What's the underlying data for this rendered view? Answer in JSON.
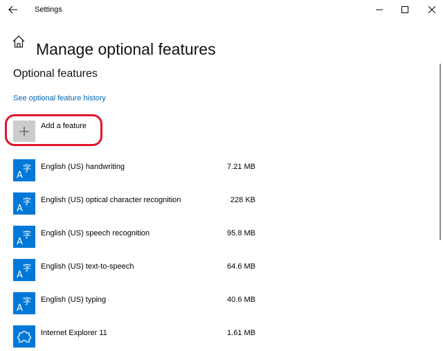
{
  "window": {
    "title": "Settings",
    "back_icon": "back-arrow-icon",
    "minimize_icon": "minimize-icon",
    "maximize_icon": "maximize-icon",
    "close_icon": "close-icon"
  },
  "page": {
    "title": "Manage optional features",
    "home_icon": "home-icon"
  },
  "section": {
    "title": "Optional features",
    "history_link": "See optional feature history"
  },
  "add_feature": {
    "label": "Add a feature",
    "icon": "plus-icon",
    "highlight_color": "#e0142a"
  },
  "features": [
    {
      "name": "English (US) handwriting",
      "size": "7.21 MB",
      "icon": "language-icon"
    },
    {
      "name": "English (US) optical character recognition",
      "size": "228 KB",
      "icon": "language-icon"
    },
    {
      "name": "English (US) speech recognition",
      "size": "95.8 MB",
      "icon": "language-icon"
    },
    {
      "name": "English (US) text-to-speech",
      "size": "64.6 MB",
      "icon": "language-icon"
    },
    {
      "name": "English (US) typing",
      "size": "40.6 MB",
      "icon": "language-icon"
    },
    {
      "name": "Internet Explorer 11",
      "size": "1.61 MB",
      "icon": "puzzle-icon"
    }
  ],
  "colors": {
    "accent": "#0078d7",
    "link": "#0063b1",
    "add_tile": "#cccccc"
  }
}
